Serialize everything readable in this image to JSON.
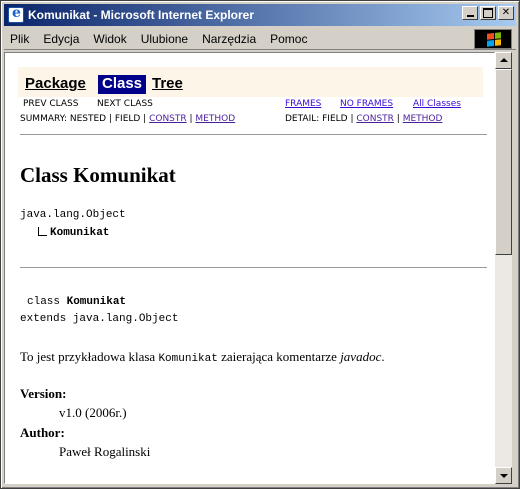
{
  "window": {
    "title": "Komunikat - Microsoft Internet Explorer"
  },
  "menu": {
    "items": [
      "Plik",
      "Edycja",
      "Widok",
      "Ulubione",
      "Narzędzia",
      "Pomoc"
    ]
  },
  "navbar": {
    "package": "Package",
    "class": "Class",
    "tree": "Tree",
    "prev_class": "PREV CLASS",
    "next_class": "NEXT CLASS",
    "frames": "FRAMES",
    "no_frames": "NO FRAMES",
    "all_classes": "All Classes",
    "summary_prefix": "SUMMARY: NESTED | FIELD | ",
    "summary_constr": "CONSTR",
    "sep": " | ",
    "summary_method": "METHOD",
    "detail_prefix": "DETAIL: FIELD | ",
    "detail_constr": "CONSTR",
    "detail_method": "METHOD"
  },
  "content": {
    "heading": "Class Komunikat",
    "hierarchy_root": "java.lang.Object",
    "hierarchy_child": "Komunikat",
    "decl_keyword": "class ",
    "decl_name": "Komunikat",
    "extends_line": "extends java.lang.Object",
    "desc_before": "To jest przykładowa klasa ",
    "desc_code": "Komunikat",
    "desc_after": " zaierająca komentarze ",
    "desc_italic": "javadoc",
    "desc_end": ".",
    "version_label": "Version:",
    "version_value": "v1.0 (2006r.)",
    "author_label": "Author:",
    "author_value": "Paweł Rogalinski"
  }
}
